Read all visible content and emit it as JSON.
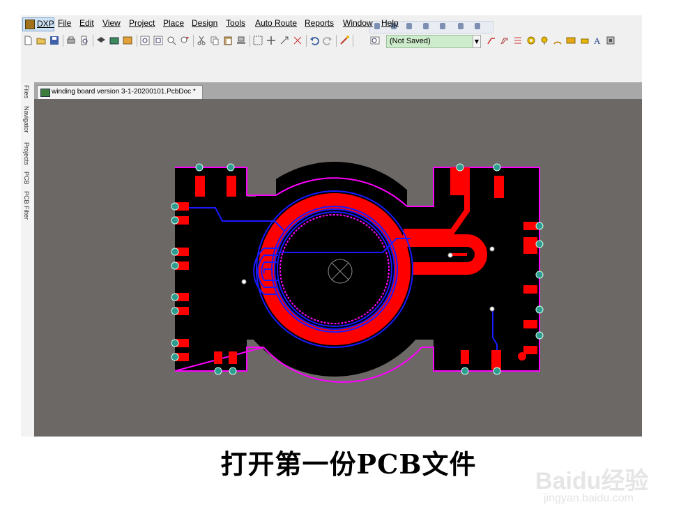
{
  "app": {
    "logo_label": "DXP"
  },
  "menu": [
    "File",
    "Edit",
    "View",
    "Project",
    "Place",
    "Design",
    "Tools",
    "Auto Route",
    "Reports",
    "Window",
    "Help"
  ],
  "toolbar": {
    "combo_value": "(Not Saved)"
  },
  "side_tabs": [
    "Files",
    "Navigator",
    "Projects",
    "PCB",
    "PCB Filter"
  ],
  "document_tab": {
    "label": "winding board version 3-1-20200101.PcbDoc *"
  },
  "colors": {
    "board": "#000000",
    "top_layer": "#ff0000",
    "bottom_layer": "#0000ff",
    "outline": "#ff00ff",
    "canvas": "#6c6866",
    "pad_ring": "#2e9d8f"
  },
  "caption": "打开第一份PCB文件",
  "watermark": {
    "logo": "Baidu经验",
    "url": "jingyan.baidu.com"
  }
}
